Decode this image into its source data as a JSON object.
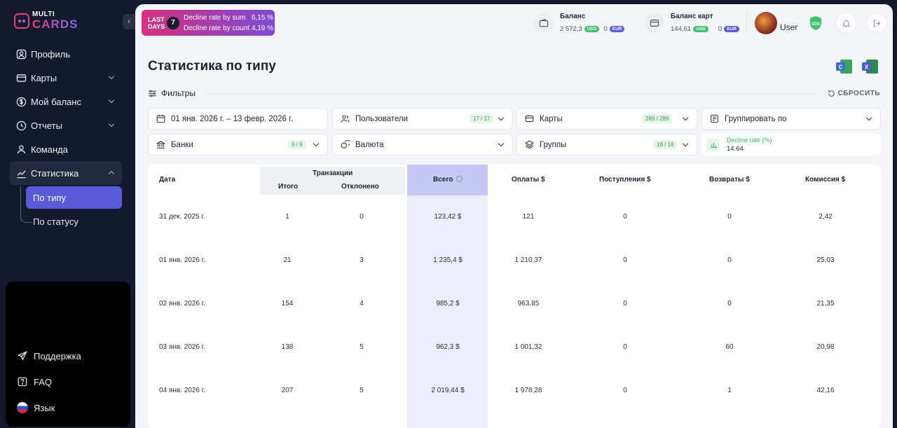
{
  "logo": {
    "top": "MULTI",
    "bottom": "CARDS"
  },
  "sidebar": {
    "items": [
      {
        "label": "Профиль"
      },
      {
        "label": "Карты"
      },
      {
        "label": "Мой баланс"
      },
      {
        "label": "Отчеты"
      },
      {
        "label": "Команда"
      },
      {
        "label": "Статистика"
      }
    ],
    "sub_items": [
      {
        "label": "По типу"
      },
      {
        "label": "По статусу"
      }
    ],
    "bottom": [
      {
        "label": "Поддержка"
      },
      {
        "label": "FAQ"
      },
      {
        "label": "Язык"
      }
    ]
  },
  "promo": {
    "last": "LAST",
    "days": "DAYS",
    "count": "7",
    "rows": [
      {
        "label": "Decline rate by sum",
        "value": "6,15 %"
      },
      {
        "label": "Decline rate by count",
        "value": "4,19 %"
      }
    ]
  },
  "balance": {
    "title": "Баланс",
    "usd": "2 572,3",
    "usd_cur": "USD",
    "eur": "0",
    "eur_cur": "EUR"
  },
  "card_balance": {
    "title": "Баланс карт",
    "usd": "144,61",
    "usd_cur": "USD",
    "eur": "0",
    "eur_cur": "EUR"
  },
  "user": {
    "name": "User",
    "badge": "3DS"
  },
  "page": {
    "title": "Статистика по типу"
  },
  "filters": {
    "label": "Фильтры",
    "reset": "СБРОСИТЬ",
    "date_range": "01 янв. 2026 г. – 13 февр. 2026 г.",
    "users": {
      "label": "Пользователи",
      "count": "17 / 17"
    },
    "cards": {
      "label": "Карты",
      "count": "289 / 289"
    },
    "group_by": {
      "label": "Группировать по"
    },
    "banks": {
      "label": "Банки",
      "count": "9 / 9"
    },
    "currency": {
      "label": "Валюта"
    },
    "groups": {
      "label": "Группы",
      "count": "18 / 18"
    },
    "decline_rate": {
      "label": "Decline rate (%)",
      "value": "14.64"
    }
  },
  "table": {
    "headers": {
      "date": "Дата",
      "transactions": "Транзакции",
      "total_tx": "Итого",
      "declined": "Отклонено",
      "all": "Всего",
      "payments": "Оплаты $",
      "receipts": "Поступления $",
      "refunds": "Возвраты $",
      "commission": "Комиссия $"
    },
    "rows": [
      {
        "date": "31 дек. 2025 г.",
        "total": "1",
        "declined": "0",
        "all": "123,42 $",
        "payments": "121",
        "receipts": "0",
        "refunds": "0",
        "commission": "2,42"
      },
      {
        "date": "01 янв. 2026 г.",
        "total": "21",
        "declined": "3",
        "all": "1 235,4 $",
        "payments": "1 210,37",
        "receipts": "0",
        "refunds": "0",
        "commission": "25,03"
      },
      {
        "date": "02 янв. 2026 г.",
        "total": "154",
        "declined": "4",
        "all": "985,2 $",
        "payments": "963,85",
        "receipts": "0",
        "refunds": "0",
        "commission": "21,35"
      },
      {
        "date": "03 янв. 2026 г.",
        "total": "138",
        "declined": "5",
        "all": "962,3 $",
        "payments": "1 001,32",
        "receipts": "0",
        "refunds": "60",
        "commission": "20,98"
      },
      {
        "date": "04 янв. 2026 г.",
        "total": "207",
        "declined": "5",
        "all": "2 019,44 $",
        "payments": "1 978,28",
        "receipts": "0",
        "refunds": "1",
        "commission": "42,16"
      }
    ]
  }
}
